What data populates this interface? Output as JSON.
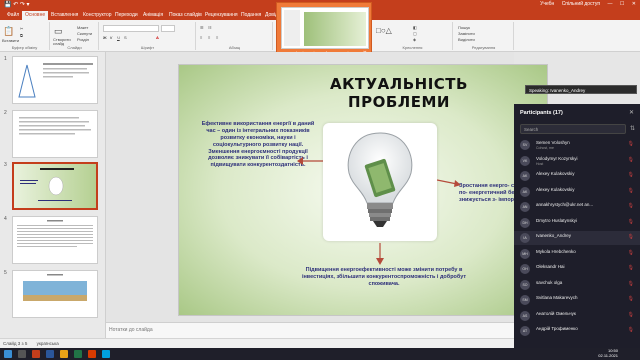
{
  "titlebar": {
    "user": "Учебн",
    "account": "Спільний доступ"
  },
  "tabs": [
    "Файл",
    "Основне",
    "Вставлення",
    "Конструктор",
    "Переходи",
    "Анімація",
    "Показ слайдів",
    "Рецензування",
    "Подання",
    "Довідка"
  ],
  "ribbon": {
    "groups": [
      "Буфер обміну",
      "Слайди",
      "Шрифт",
      "Абзац",
      "Креслення",
      "Редагування"
    ],
    "buttons": [
      "Вставити",
      "Створити слайд",
      "Макет",
      "Скинути",
      "Розділ",
      "Пошук",
      "Замінити",
      "Виділити"
    ]
  },
  "share_popup": {
    "caption": "You're sharing Microsoft PowerPoin..."
  },
  "slide_pane": {
    "count": "5",
    "selected": "3"
  },
  "slide": {
    "title": "АКТУАЛЬНІСТЬ ПРОБЛЕМИ",
    "left_text": "Ефективне використання енергії в даний час – один із інтегральних показників розвитку економіки, науки і соціокультурного розвитку нації. Зменшення енергоємності продукції дозволяє знижувати її собівартість і підвищувати конкурентоздатність.",
    "right_text": "Зростання енерго- сприятливо по- енергетичний бе- знижується з- імпорту",
    "bottom_text": "Підвищення енергоефективності може змінити потребу в інвестиціях, збільшити конкурентоспроможність і добробут споживача."
  },
  "notes": {
    "placeholder": "Нотатки до слайда"
  },
  "statusbar": {
    "slide": "Слайд 3 з 5",
    "language": "українська"
  },
  "speaking": {
    "label": "Speaking: Ivanenko_Andrey"
  },
  "participants": {
    "title": "Participants (17)",
    "search_placeholder": "Search",
    "list": [
      {
        "initials": "SV",
        "name": "Semen Voloshyn",
        "sub": "Cohost, me"
      },
      {
        "initials": "VK",
        "name": "Volodymyr Kozyrskyi",
        "sub": "Host"
      },
      {
        "initials": "AK",
        "name": "Alexey Kulakovskiy",
        "sub": ""
      },
      {
        "initials": "AK",
        "name": "Alexey Kulakovskiy",
        "sub": ""
      },
      {
        "initials": "AN",
        "name": "annakhrystych@ukr.net an...",
        "sub": ""
      },
      {
        "initials": "DH",
        "name": "Dmytro Huslatynskyi",
        "sub": ""
      },
      {
        "initials": "IA",
        "name": "Ivanenko_Andrey",
        "sub": ""
      },
      {
        "initials": "MH",
        "name": "Mykola Hrebchenko",
        "sub": ""
      },
      {
        "initials": "OH",
        "name": "Oleksandr Hai",
        "sub": ""
      },
      {
        "initials": "SO",
        "name": "savchuk olga",
        "sub": ""
      },
      {
        "initials": "SM",
        "name": "Svitlana Makarevych",
        "sub": ""
      },
      {
        "initials": "AS",
        "name": "Анатолій Омельчук",
        "sub": ""
      },
      {
        "initials": "AT",
        "name": "Андрій Трофименко",
        "sub": ""
      }
    ]
  },
  "taskbar": {
    "time": "10:50",
    "date": "02.11.2021"
  },
  "colors": {
    "accent": "#c43e1c",
    "slide_text": "#2d2f7a",
    "panel_bg": "#1e1e2a"
  }
}
